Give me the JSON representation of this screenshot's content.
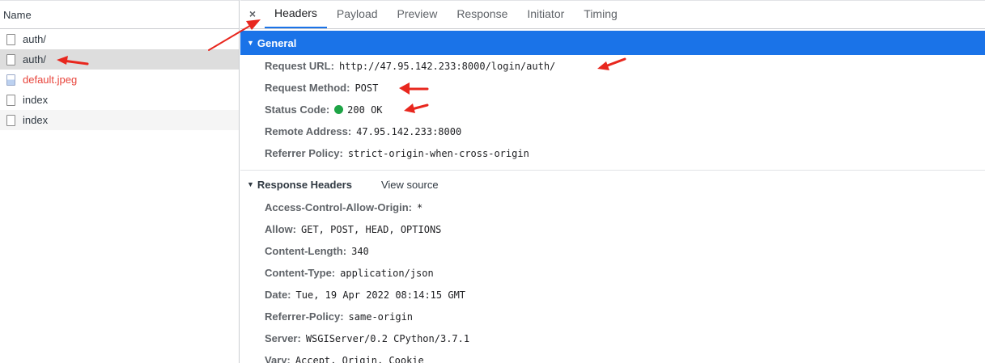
{
  "list": {
    "header": "Name",
    "items": [
      {
        "label": "auth/",
        "type": "doc"
      },
      {
        "label": "auth/",
        "type": "doc"
      },
      {
        "label": "default.jpeg",
        "type": "img"
      },
      {
        "label": "index",
        "type": "doc"
      },
      {
        "label": "index",
        "type": "doc"
      }
    ]
  },
  "tabs": {
    "close": "×",
    "items": [
      "Headers",
      "Payload",
      "Preview",
      "Response",
      "Initiator",
      "Timing"
    ],
    "active": "Headers"
  },
  "general": {
    "title": "General",
    "rows": [
      {
        "key": "Request URL:",
        "value": "http://47.95.142.233:8000/login/auth/"
      },
      {
        "key": "Request Method:",
        "value": "POST"
      },
      {
        "key": "Status Code:",
        "value": "200 OK",
        "status_color": "#1ea446"
      },
      {
        "key": "Remote Address:",
        "value": "47.95.142.233:8000"
      },
      {
        "key": "Referrer Policy:",
        "value": "strict-origin-when-cross-origin"
      }
    ]
  },
  "response_headers": {
    "title": "Response Headers",
    "view_source": "View source",
    "rows": [
      {
        "key": "Access-Control-Allow-Origin:",
        "value": "*"
      },
      {
        "key": "Allow:",
        "value": "GET, POST, HEAD, OPTIONS"
      },
      {
        "key": "Content-Length:",
        "value": "340"
      },
      {
        "key": "Content-Type:",
        "value": "application/json"
      },
      {
        "key": "Date:",
        "value": "Tue, 19 Apr 2022 08:14:15 GMT"
      },
      {
        "key": "Referrer-Policy:",
        "value": "same-origin"
      },
      {
        "key": "Server:",
        "value": "WSGIServer/0.2 CPython/3.7.1"
      },
      {
        "key": "Vary:",
        "value": "Accept, Origin, Cookie"
      }
    ]
  },
  "colors": {
    "accent": "#1a73e8",
    "annotation_arrow": "#e8271e",
    "error_text": "#e8453c"
  }
}
